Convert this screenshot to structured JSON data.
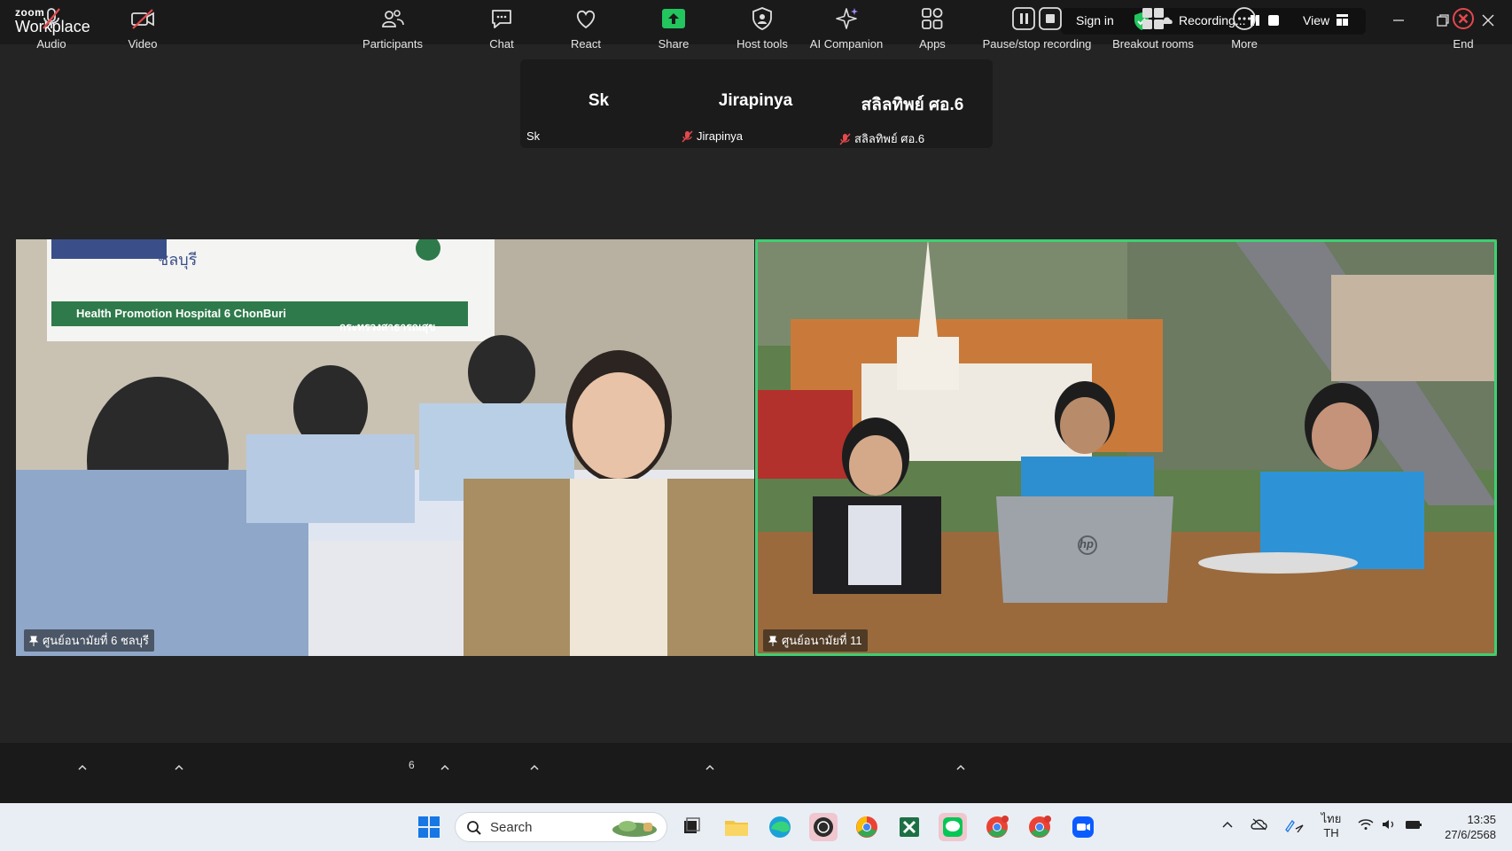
{
  "app": {
    "logo_top": "zoom",
    "logo_bottom": "Workplace"
  },
  "titlebar": {
    "sign_in": "Sign in",
    "recording": "Recording...",
    "view": "View"
  },
  "gallery_strip": [
    {
      "display": "Sk",
      "label": "Sk",
      "muted": false
    },
    {
      "display": "Jirapinya",
      "label": "Jirapinya",
      "muted": true
    },
    {
      "display": "สลิลทิพย์ ศอ.6",
      "label": "สลิลทิพย์ ศอ.6",
      "muted": true
    }
  ],
  "videos": [
    {
      "label": "ศูนย์อนามัยที่ 6 ชลบุรี",
      "banner_title": "Health Promotion Hospital 6 ChonBuri",
      "banner_right": "กระทรวงสาธารณสุข",
      "banner_top": "ชลบุรี",
      "active": false
    },
    {
      "label": "ศูนย์อนามัยที่ 11",
      "active": true,
      "laptop_logo": "hp"
    }
  ],
  "toolbar": {
    "audio": "Audio",
    "video": "Video",
    "participants": "Participants",
    "participants_count": "6",
    "chat": "Chat",
    "react": "React",
    "share": "Share",
    "host_tools": "Host tools",
    "ai_companion": "AI Companion",
    "apps": "Apps",
    "pause_stop_recording": "Pause/stop recording",
    "breakout_rooms": "Breakout rooms",
    "more": "More",
    "end": "End"
  },
  "taskbar": {
    "search_placeholder": "Search",
    "lang_top": "ไทย",
    "lang_bottom": "TH",
    "time": "13:35",
    "date": "27/6/2568"
  },
  "colors": {
    "active_border": "#3ecf72",
    "share_green": "#22c55e",
    "end_red": "#e5484d",
    "background": "#242424"
  }
}
